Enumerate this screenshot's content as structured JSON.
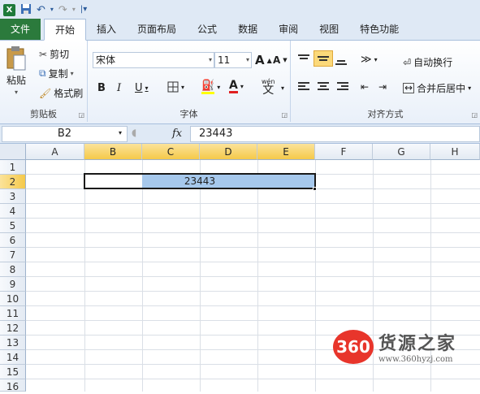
{
  "qat": {
    "logo": "X",
    "save_icon": "save-icon",
    "undo_icon": "undo-icon",
    "redo_icon": "redo-icon"
  },
  "tabs": [
    "文件",
    "开始",
    "插入",
    "页面布局",
    "公式",
    "数据",
    "审阅",
    "视图",
    "特色功能"
  ],
  "clipboard": {
    "paste": "粘贴",
    "cut": "剪切",
    "copy": "复制",
    "format_painter": "格式刷",
    "label": "剪贴板"
  },
  "font": {
    "name": "宋体",
    "size": "11",
    "bold": "B",
    "italic": "I",
    "underline": "U",
    "label": "字体",
    "wen": "wén",
    "grow": "A",
    "shrink": "A"
  },
  "alignment": {
    "wrap": "自动换行",
    "merge": "合并后居中",
    "label": "对齐方式"
  },
  "formula_bar": {
    "name_box": "B2",
    "fx": "fx",
    "value": "23443"
  },
  "columns": [
    "A",
    "B",
    "C",
    "D",
    "E",
    "F",
    "G",
    "H"
  ],
  "rows": [
    "1",
    "2",
    "3",
    "4",
    "5",
    "6",
    "7",
    "8",
    "9",
    "10",
    "11",
    "12",
    "13",
    "14",
    "15",
    "16"
  ],
  "selection": {
    "ref": "B2:E2",
    "value": "23443"
  },
  "watermark": {
    "logo": "360",
    "title": "货源之家",
    "url": "www.360hyzj.com"
  },
  "colors": {
    "file_tab": "#2b7a3c",
    "selected_header": "#f5c94a",
    "selection_fill": "#a6c8ec"
  }
}
